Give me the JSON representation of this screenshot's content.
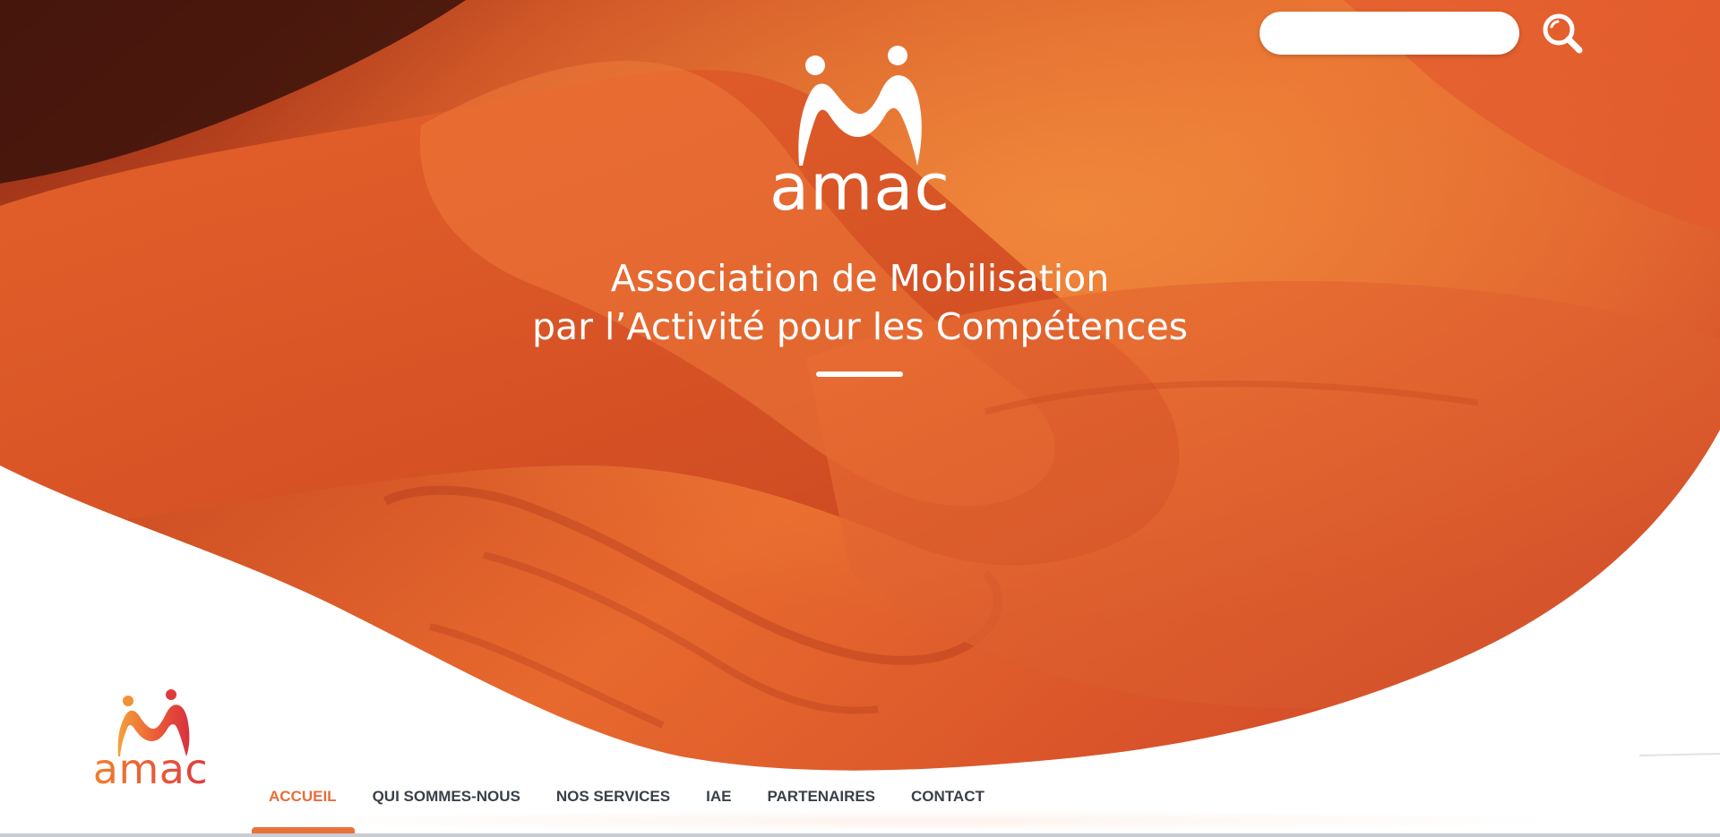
{
  "header": {
    "search": {
      "placeholder": "",
      "value": ""
    },
    "search_icon": "search-icon"
  },
  "hero": {
    "logo_text": "amac",
    "tagline_line1": "Association de Mobilisation",
    "tagline_line2": "par l’Activité pour les Compétences"
  },
  "site_logo": {
    "text": "amac"
  },
  "nav": {
    "items": [
      {
        "label": "ACCUEIL",
        "active": true
      },
      {
        "label": "QUI SOMMES-NOUS",
        "active": false
      },
      {
        "label": "NOS SERVICES",
        "active": false
      },
      {
        "label": "IAE",
        "active": false
      },
      {
        "label": "PARTENAIRES",
        "active": false
      },
      {
        "label": "CONTACT",
        "active": false
      }
    ]
  },
  "colors": {
    "brand_orange": "#e8733a",
    "brand_red": "#d8323f",
    "nav_text": "#3a3f4a"
  }
}
